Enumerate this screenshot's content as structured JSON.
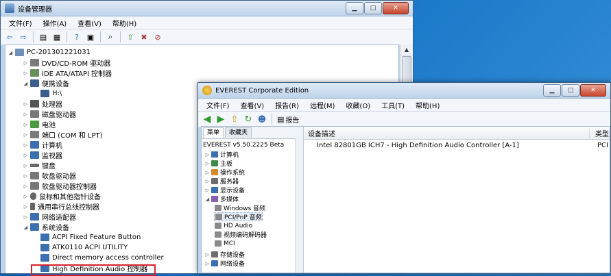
{
  "device_manager": {
    "title": "设备管理器",
    "menu": [
      "文件(F)",
      "操作(A)",
      "查看(V)",
      "帮助(H)"
    ],
    "toolbar_icons": [
      "back-icon",
      "forward-icon",
      "computer-icon",
      "properties-icon",
      "help-icon",
      "properties-icon",
      "scan-icon",
      "update-driver-icon",
      "disable-icon",
      "uninstall-icon"
    ],
    "tree": [
      {
        "label": "PC-201301221031",
        "icon_color": "#6f8fb8"
      },
      {
        "label": "DVD/CD-ROM 驱动器",
        "icon_color": "#7b7b7b"
      },
      {
        "label": "IDE ATA/ATAPI 控制器",
        "icon_color": "#6b8f5a"
      },
      {
        "label": "便携设备",
        "icon_color": "#3b5f8d"
      },
      {
        "label": "H:\\",
        "icon_color": "#3b5f8d"
      },
      {
        "label": "处理器",
        "icon_color": "#555"
      },
      {
        "label": "磁盘驱动器",
        "icon_color": "#777"
      },
      {
        "label": "电池",
        "icon_color": "#4c9a3e"
      },
      {
        "label": "端口 (COM 和 LPT)",
        "icon_color": "#7b7b7b"
      },
      {
        "label": "计算机",
        "icon_color": "#3b6fb0"
      },
      {
        "label": "监视器",
        "icon_color": "#3b6fb0"
      },
      {
        "label": "键盘",
        "icon_color": "#666"
      },
      {
        "label": "软盘驱动器",
        "icon_color": "#777"
      },
      {
        "label": "软盘驱动器控制器",
        "icon_color": "#777"
      },
      {
        "label": "鼠标和其他指针设备",
        "icon_color": "#666"
      },
      {
        "label": "通用串行总线控制器",
        "icon_color": "#666"
      },
      {
        "label": "网络适配器",
        "icon_color": "#3b6fb0"
      },
      {
        "label": "系统设备",
        "icon_color": "#3b6fb0"
      },
      {
        "label": "ACPI Fixed Feature Button",
        "icon_color": "#3b6fb0"
      },
      {
        "label": "ATK0110 ACPI UTILITY",
        "icon_color": "#3b6fb0"
      },
      {
        "label": "Direct memory access controller",
        "icon_color": "#3b6fb0"
      },
      {
        "label": "High Definition Audio 控制器",
        "icon_color": "#3b6fb0"
      }
    ]
  },
  "everest": {
    "title": "EVEREST Corporate Edition",
    "menu": [
      "文件(F)",
      "查看(V)",
      "报告(R)",
      "远程(M)",
      "收藏(O)",
      "工具(T)",
      "帮助(H)"
    ],
    "toolbar": {
      "report_label": "报告"
    },
    "tabs": [
      "菜单",
      "收藏夹"
    ],
    "tree": [
      {
        "label": "EVEREST v5.50.2225 Beta"
      },
      {
        "label": "计算机"
      },
      {
        "label": "主板"
      },
      {
        "label": "操作系统"
      },
      {
        "label": "服务器"
      },
      {
        "label": "显示设备"
      },
      {
        "label": "多媒体"
      },
      {
        "label": "Windows 音频"
      },
      {
        "label": "PCI/PnP 音频"
      },
      {
        "label": "HD Audio"
      },
      {
        "label": "视频编码解码器"
      },
      {
        "label": "MCI"
      },
      {
        "label": "存储设备"
      },
      {
        "label": "网络设备"
      }
    ],
    "columns": [
      "设备描述",
      "类型"
    ],
    "rows": [
      {
        "description": "Intel 82801GB ICH7 - High Definition Audio Controller [A-1]",
        "type": "PCI"
      }
    ]
  },
  "colors": {
    "highlight": "#d8212a",
    "titlebar": "#bed3ea",
    "desktop": "#1a78c9"
  }
}
